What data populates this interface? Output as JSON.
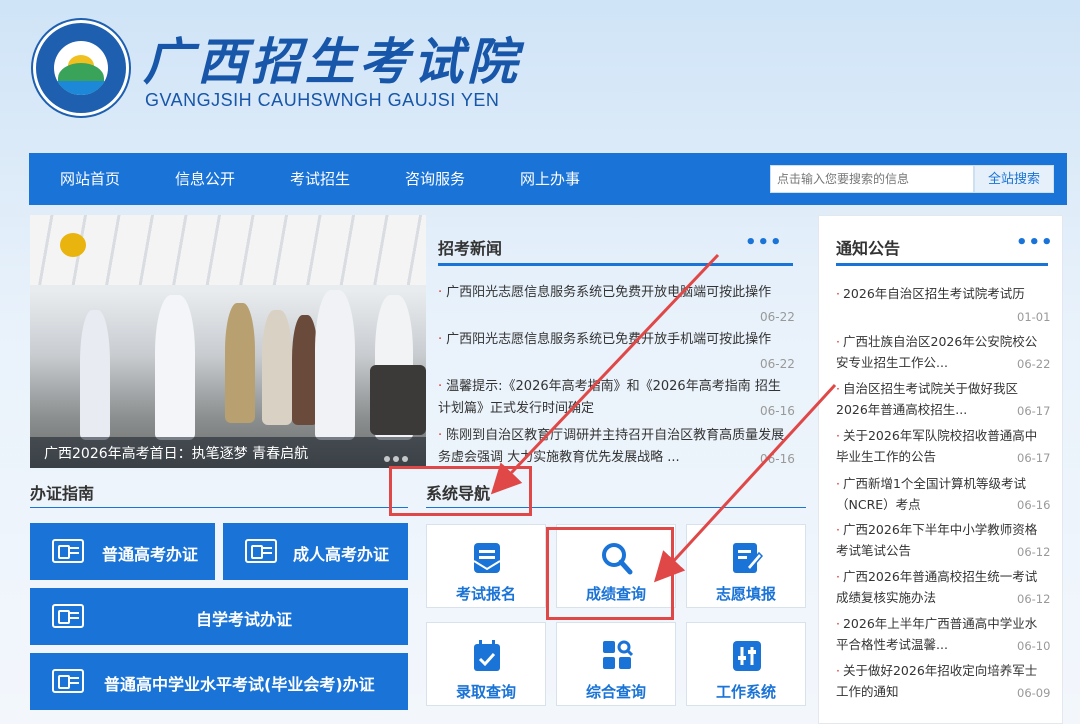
{
  "header": {
    "title": "广西招生考试院",
    "subtitle": "GVANGJSIH CAUHSWNGH GAUJSI YEN"
  },
  "nav": {
    "items": [
      "网站首页",
      "信息公开",
      "考试招生",
      "咨询服务",
      "网上办事"
    ],
    "search_placeholder": "点击输入您要搜索的信息",
    "search_button": "全站搜索"
  },
  "photo": {
    "caption": "广西2026年高考首日：执笔逐梦 青春启航"
  },
  "news": {
    "title": "招考新闻",
    "more": "•••",
    "items": [
      {
        "text": "广西阳光志愿信息服务系统已免费开放电脑端可按此操作",
        "date": "06-22"
      },
      {
        "text": "广西阳光志愿信息服务系统已免费开放手机端可按此操作",
        "date": "06-22"
      },
      {
        "text": "温馨提示:《2026年高考指南》和《2026年高考指南 招生计划篇》正式发行时间确定",
        "date": "06-16"
      },
      {
        "text": "陈刚到自治区教育厅调研并主持召开自治区教育高质量发展务虚会强调 大力实施教育优先发展战略 ...",
        "date": "06-16"
      }
    ]
  },
  "notice": {
    "title": "通知公告",
    "more": "•••",
    "items": [
      {
        "text": "2026年自治区招生考试院考试历",
        "date": "01-01"
      },
      {
        "text": "广西壮族自治区2026年公安院校公安专业招生工作公...",
        "date": "06-22"
      },
      {
        "text": "自治区招生考试院关于做好我区2026年普通高校招生...",
        "date": "06-17"
      },
      {
        "text": "关于2026年军队院校招收普通高中毕业生工作的公告",
        "date": "06-17"
      },
      {
        "text": "广西新增1个全国计算机等级考试（NCRE）考点",
        "date": "06-16"
      },
      {
        "text": "广西2026年下半年中小学教师资格考试笔试公告",
        "date": "06-12"
      },
      {
        "text": "广西2026年普通高校招生统一考试成绩复核实施办法",
        "date": "06-12"
      },
      {
        "text": "2026年上半年广西普通高中学业水平合格性考试温馨...",
        "date": "06-10"
      },
      {
        "text": "关于做好2026年招收定向培养军士工作的通知",
        "date": "06-09"
      }
    ]
  },
  "guide": {
    "title": "办证指南",
    "buttons": [
      "普通高考办证",
      "成人高考办证",
      "自学考试办证",
      "普通高中学业水平考试(毕业会考)办证"
    ]
  },
  "system_nav": {
    "title": "系统导航",
    "tiles": [
      "考试报名",
      "成绩查询",
      "志愿填报",
      "录取查询",
      "综合查询",
      "工作系统"
    ]
  },
  "colors": {
    "primary": "#1a73d6",
    "accent_red": "#e04848",
    "bullet_red": "#d4302a"
  }
}
